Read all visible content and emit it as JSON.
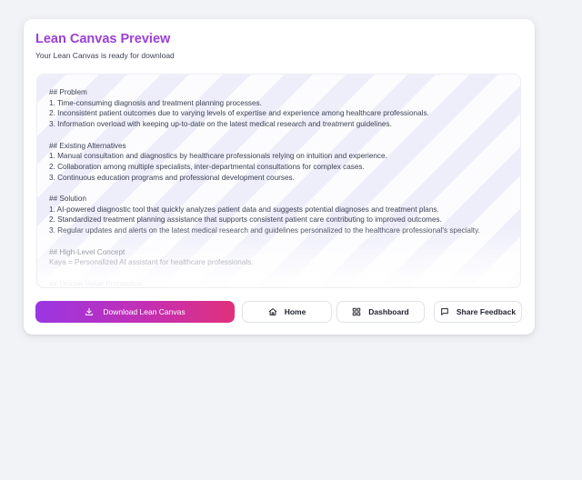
{
  "header": {
    "title": "Lean Canvas Preview",
    "subtitle": "Your Lean Canvas is ready for download"
  },
  "preview": {
    "content": "## Problem\n1. Time-consuming diagnosis and treatment planning processes.\n2. Inconsistent patient outcomes due to varying levels of expertise and experience among healthcare professionals.\n3. Information overload with keeping up-to-date on the latest medical research and treatment guidelines.\n\n## Existing Alternatives\n1. Manual consultation and diagnostics by healthcare professionals relying on intuition and experience.\n2. Collaboration among multiple specialists, inter-departmental consultations for complex cases.\n3. Continuous education programs and professional development courses.\n\n## Solution\n1. AI-powered diagnostic tool that quickly analyzes patient data and suggests potential diagnoses and treatment plans.\n2. Standardized treatment planning assistance that supports consistent patient care contributing to improved outcomes.\n3. Regular updates and alerts on the latest medical research and guidelines personalized to the healthcare professional's specialty.\n\n## High-Level Concept\nKaya = Personalized AI assistant for healthcare professionals.\n\n## Unique Value Proposition"
  },
  "actions": {
    "download_label": "Download Lean Canvas",
    "home_label": "Home",
    "dashboard_label": "Dashboard",
    "feedback_label": "Share Feedback"
  },
  "icons": {
    "download": "download-icon",
    "home": "home-icon",
    "dashboard": "dashboard-grid-icon",
    "feedback": "message-square-icon"
  },
  "colors": {
    "title": "#9b3fd6",
    "primary_gradient_start": "#9a36e3",
    "primary_gradient_end": "#e0307c"
  }
}
